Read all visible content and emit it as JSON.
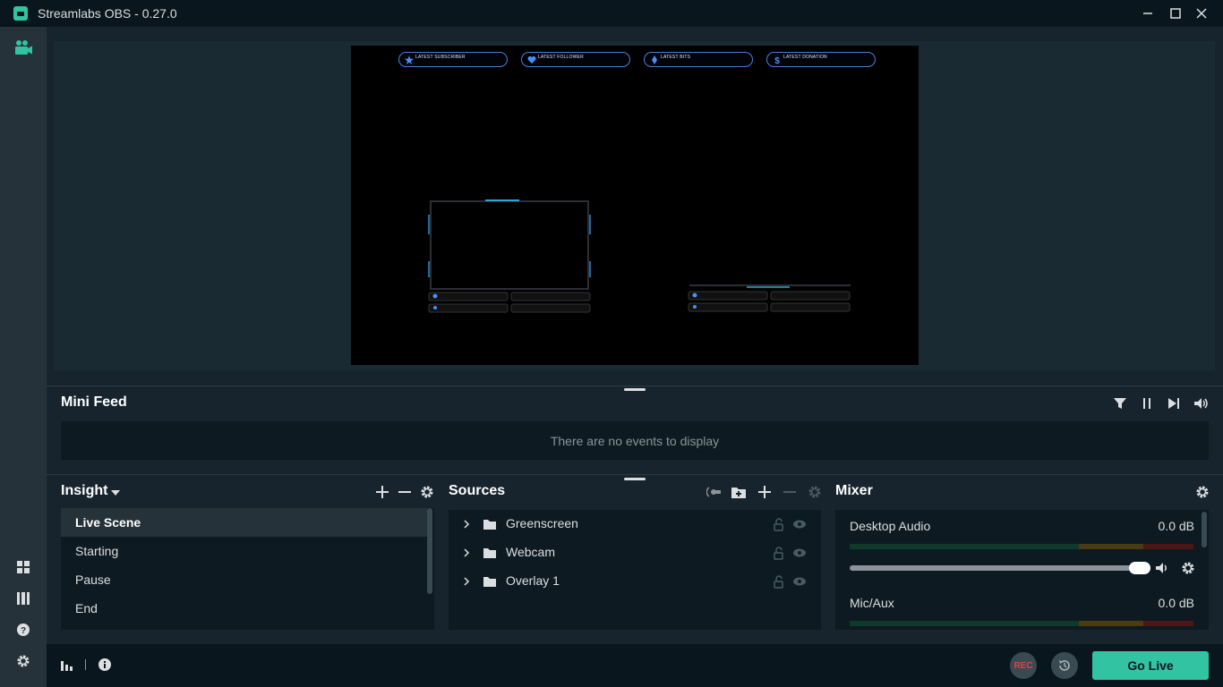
{
  "window": {
    "title": "Streamlabs OBS - 0.27.0"
  },
  "preview": {
    "widgets": [
      {
        "label": "LATEST SUBSCRIBER",
        "icon": "star-icon"
      },
      {
        "label": "LATEST FOLLOWER",
        "icon": "heart-icon"
      },
      {
        "label": "LATEST BITS",
        "icon": "diamond-icon"
      },
      {
        "label": "LATEST DONATION",
        "icon": "dollar-icon"
      }
    ]
  },
  "mini_feed": {
    "title": "Mini Feed",
    "empty_text": "There are no events to display"
  },
  "scenes": {
    "title": "Insight",
    "items": [
      {
        "label": "Live Scene",
        "active": true
      },
      {
        "label": "Starting"
      },
      {
        "label": "Pause"
      },
      {
        "label": "End"
      }
    ]
  },
  "sources": {
    "title": "Sources",
    "items": [
      {
        "name": "Greenscreen"
      },
      {
        "name": "Webcam"
      },
      {
        "name": "Overlay 1"
      }
    ]
  },
  "mixer": {
    "title": "Mixer",
    "channels": [
      {
        "name": "Desktop Audio",
        "level": "0.0 dB",
        "volume": 1.0
      },
      {
        "name": "Mic/Aux",
        "level": "0.0 dB"
      }
    ]
  },
  "footer": {
    "rec_label": "REC",
    "go_live_label": "Go Live"
  },
  "colors": {
    "accent": "#31c3a2",
    "background": "#17242d",
    "panel": "#0d1a21",
    "titlebar": "#09161d"
  }
}
